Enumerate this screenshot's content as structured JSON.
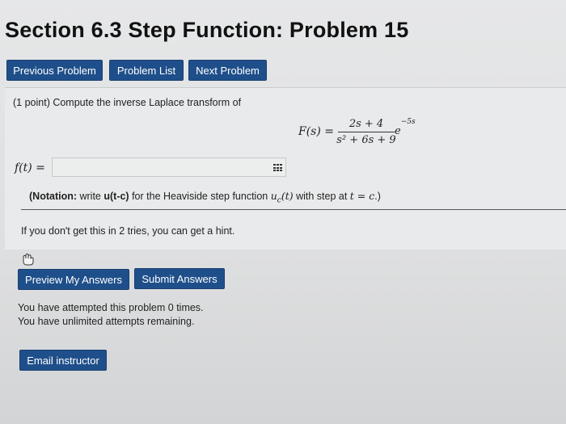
{
  "header": {
    "title": "Section 6.3 Step Function: Problem 15"
  },
  "nav": {
    "previous": "Previous Problem",
    "list": "Problem List",
    "next": "Next Problem"
  },
  "problem": {
    "intro": "(1 point) Compute the inverse Laplace transform of",
    "lhs": "F(s) =",
    "numerator": "2s + 4",
    "denominator": "s² + 6s + 9",
    "exponential": "e",
    "exponent": "−5s",
    "answer_label": "f(t) =",
    "answer_value": "",
    "notation_bold": "(Notation:",
    "notation_text": " write ",
    "notation_code": "u(t-c)",
    "notation_rest": " for the Heaviside step function ",
    "notation_math": "u",
    "notation_sub": "c",
    "notation_math2": "(t)",
    "notation_tail": " with step at ",
    "notation_math3": "t = c",
    "notation_end": ".)"
  },
  "hint": {
    "text": "If you don't get this in 2 tries, you can get a hint."
  },
  "actions": {
    "preview": "Preview My Answers",
    "submit": "Submit Answers"
  },
  "status": {
    "attempted": "You have attempted this problem 0 times.",
    "remaining": "You have unlimited attempts remaining."
  },
  "footer": {
    "email": "Email instructor"
  },
  "colors": {
    "button_bg": "#1f4f8a",
    "page_bg": "#e6e7e8"
  },
  "icons": {
    "hint": "hand-pointer-icon",
    "input_tool": "grid-icon"
  }
}
